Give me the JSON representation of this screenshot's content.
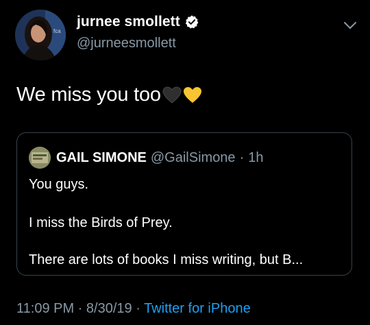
{
  "author": {
    "display_name": "jurnee smollett",
    "handle": "@jurneesmollett",
    "verified": true
  },
  "tweet": {
    "text": "We miss you too",
    "emoji": [
      "black-heart",
      "yellow-heart"
    ]
  },
  "quoted_tweet": {
    "display_name": "GAIL SIMONE",
    "handle": "@GailSimone",
    "separator": "·",
    "time": "1h",
    "lines": [
      "You guys.",
      "I miss the Birds of Prey.",
      "There are lots of books I miss writing, but B..."
    ]
  },
  "meta": {
    "time": "11:09 PM",
    "separator1": " · ",
    "date": "8/30/19",
    "separator2": " · ",
    "source": "Twitter for iPhone"
  },
  "colors": {
    "background": "#000000",
    "secondary_text": "#8899a6",
    "link": "#1da1f2",
    "border": "#38444d"
  }
}
